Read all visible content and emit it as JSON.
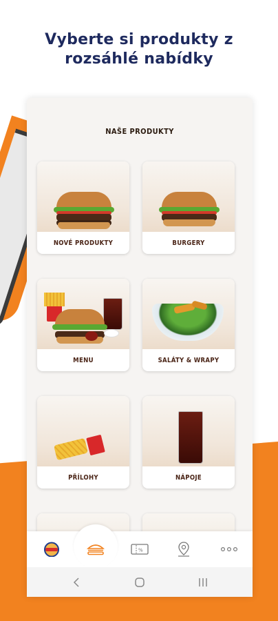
{
  "headline": {
    "line1": "Vyberte si produkty z",
    "line2": "rozsáhlé nabídky"
  },
  "screen": {
    "title": "NAŠE PRODUKTY",
    "categories": [
      {
        "label": "NOVÉ PRODUKTY",
        "icon": "burger-image"
      },
      {
        "label": "BURGERY",
        "icon": "burger-image"
      },
      {
        "label": "MENU",
        "icon": "menu-meal-image"
      },
      {
        "label": "SALÁTY & WRAPY",
        "icon": "salad-image"
      },
      {
        "label": "PŘÍLOHY",
        "icon": "fries-image"
      },
      {
        "label": "NÁPOJE",
        "icon": "drink-image"
      }
    ]
  },
  "bottom_nav": {
    "items": [
      "home-logo-icon",
      "products-burger-icon",
      "coupon-icon",
      "location-pin-icon",
      "more-dots-icon"
    ],
    "active": "products-burger-icon"
  },
  "android_nav": [
    "back-icon",
    "home-icon",
    "recents-icon"
  ],
  "colors": {
    "brand_orange": "#f2821f",
    "headline_navy": "#1e2a5e",
    "label_brown": "#4a2416"
  }
}
